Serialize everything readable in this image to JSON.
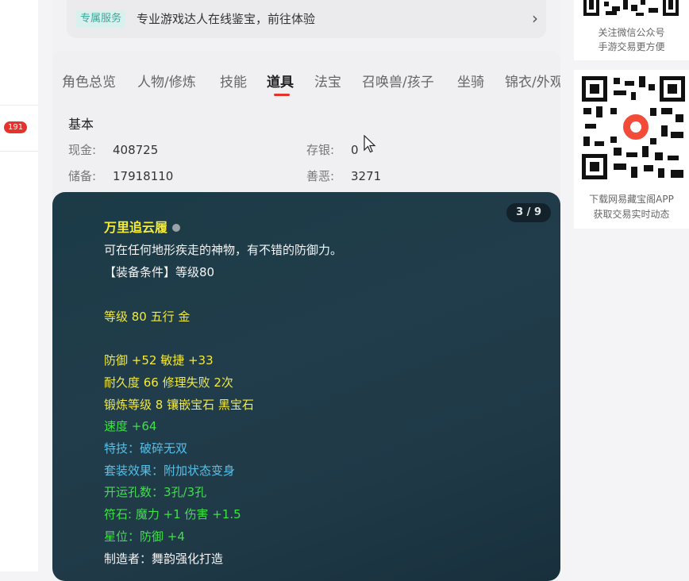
{
  "left": {
    "badge_count": "191"
  },
  "service": {
    "tag": "专属服务",
    "text": "专业游戏达人在线鉴宝，前往体验",
    "arrow_icon": "chevron-right-icon"
  },
  "tabs": [
    {
      "label": "角色总览",
      "active": false
    },
    {
      "label": "人物/修炼",
      "active": false
    },
    {
      "label": "技能",
      "active": false
    },
    {
      "label": "道具",
      "active": true
    },
    {
      "label": "法宝",
      "active": false
    },
    {
      "label": "召唤兽/孩子",
      "active": false
    },
    {
      "label": "坐骑",
      "active": false
    },
    {
      "label": "锦衣/外观",
      "active": false
    }
  ],
  "basic": {
    "title": "基本",
    "cash_label": "现金:",
    "cash_value": "408725",
    "savings_label": "存银:",
    "savings_value": "0",
    "reserve_label": "储备:",
    "reserve_value": "17918110",
    "karma_label": "善恶:",
    "karma_value": "3271"
  },
  "item": {
    "counter": "3 / 9",
    "name": "万里追云履",
    "desc": "可在任何地形疾走的神物，有不错的防御力。",
    "requirement": "【装备条件】等级80",
    "level_element": "等级 80 五行 金",
    "defense_agility": "防御 +52 敏捷 +33",
    "durability": "耐久度 66 修理失败 2次",
    "forge": "锻炼等级 8 镶嵌宝石 黑宝石",
    "speed": "速度 +64",
    "skill": "特技：破碎无双",
    "set_effect": "套装效果：附加状态变身",
    "holes": "开运孔数：3孔/3孔",
    "rune": "符石: 魔力 +1 伤害 +1.5",
    "star": "星位：防御 +4",
    "maker": "制造者：舞韵强化打造"
  },
  "right": {
    "caption1_line1": "关注微信公众号",
    "caption1_line2": "手游交易更方便",
    "caption2_line1": "下载网易藏宝阁APP",
    "caption2_line2": "获取交易实时动态"
  },
  "colors": {
    "accent": "#e5322d",
    "item_yellow": "#f3ea3a",
    "item_green": "#3fe04a",
    "item_blue": "#58c0e8"
  }
}
